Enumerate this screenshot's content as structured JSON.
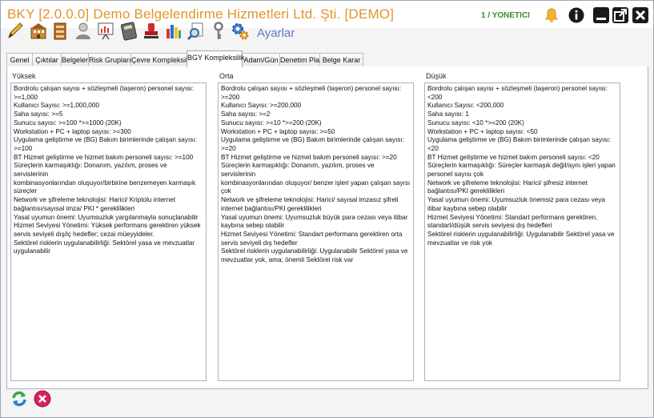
{
  "window": {
    "title": "BKY [2.0.0.0] Demo Belgelendirme Hizmetleri Ltd. Şti. [DEMO]",
    "user": "1 / YONETICI"
  },
  "titlebar_icons": [
    "bell-icon",
    "info-icon",
    "minimize-icon",
    "popout-icon",
    "close-icon"
  ],
  "toolbar": {
    "buttons": [
      "pencil-icon",
      "building-icon",
      "archive-icon",
      "user-icon",
      "presentation-icon",
      "calculator-icon",
      "stamp-icon",
      "chart-icon",
      "search-doc-icon",
      "key-icon",
      "settings-gear-icon"
    ],
    "settings_label": "Ayarlar"
  },
  "tabs": [
    {
      "label": "Genel",
      "active": false
    },
    {
      "label": "Çıktılar",
      "active": false
    },
    {
      "label": "Belgeler",
      "active": false
    },
    {
      "label": "Risk Grupları",
      "active": false
    },
    {
      "label": "Çevre Kompleksilik",
      "active": false
    },
    {
      "label": "BGY Kompleksilik",
      "active": true
    },
    {
      "label": "Adam/Gün",
      "active": false
    },
    {
      "label": "Denetim Planı",
      "active": false
    },
    {
      "label": "Belge Karar",
      "active": false
    }
  ],
  "columns": [
    {
      "header": "Yüksek",
      "lines": [
        "Bordrolu çalışan sayısı + sözleşmeli (taşeron) personel sayısı:",
        ">=1,000",
        "Kullanıcı Sayısı: >=1,000,000",
        "Saha sayısı: >=5",
        "Sunucu sayısı: >=100 *>=1000 (20K)",
        "Workstation + PC + laptop sayısı: >=300",
        "Uygulama geliştirme ve (BG) Bakım birimlerinde çalışan sayısı:",
        ">=100",
        "BT Hizmet geliştirme ve hizmet bakım personeli sayısı: >=100",
        "Süreçlerin karmaşıklığı: Donanım, yazılım, proses ve servislerinin",
        "kombinasyonlarından oluşuyor/birbirine benzemeyen karmaşık",
        "süreçler",
        "Network ve şifreleme teknolojisi: Harici/ Kriptolu internet",
        "bağlantısı/sayısal imza/ PKI * gereklilikleri",
        "Yasal uyumun önemi: Uyumsuzluk yargılanmayla sonuçlanabilir",
        "Hizmet Seviyesi Yönetimi: Yüksek performans gerektiren yüksek",
        "servis seviyeli dış/iç hedefler; cezai müeyyideler.",
        "Sektörel risklerin uygulanabilirliği: Sektörel yasa ve mevzuatlar",
        "uygulanabilir"
      ]
    },
    {
      "header": "Orta",
      "lines": [
        "Bordrolu çalışan sayısı + sözleşmeli (taşeron) personel sayısı:",
        ">=200",
        "Kullanıcı Sayısı: >=200,000",
        "Saha sayısı: >=2",
        "Sunucu sayısı: >=10 *>=200 (20K)",
        "Workstation + PC + laptop sayısı: >=50",
        "Uygulama geliştirme ve (BG) Bakım birimlerinde çalışan sayısı:",
        ">=20",
        "BT Hizmet geliştirme ve hizmet bakım personeli sayısı: >=20",
        "Süreçlerin karmaşıklığı: Donanım, yazılım, proses ve servislerinin",
        "kombinasyonlarından oluşuyor/ benzer işleri yapan çalışan sayısı",
        "çok",
        "Network ve şifreleme teknolojisi: Harici/ sayısal imzasız şifreli",
        "internet bağlantısı/PKI gereklilikleri",
        "Yasal uyumun önemi: Uyumsuzluk büyük para cezası veya itibar",
        "kaybına sebep olabilir",
        "Hizmet Seviyesi Yönetimi: Standart performans gerektiren orta",
        "servis seviyeli dış hedefler",
        "Sektörel risklerin uygulanabilirliği: Uygulanabilir Sektörel yasa ve",
        "mevzuatlar yok, ama; önemli Sektörel risk var"
      ]
    },
    {
      "header": "Düşük",
      "lines": [
        "Bordrolu çalışan sayısı + sözleşmeli (taşeron) personel sayısı:",
        "<200",
        "Kullanıcı Sayısı: <200,000",
        "Saha sayısı: 1",
        "Sunucu sayısı: <10 *>=200 (20K)",
        "Workstation + PC + laptop sayısı: <50",
        "Uygulama geliştirme ve (BG) Bakım birimlerinde çalışan sayısı:",
        "<20",
        "BT Hizmet geliştirme ve hizmet bakım personeli sayısı: <20",
        "Süreçlerin karmaşıklığı: Süreçler karmaşık değil/aynı işleri yapan",
        "personel sayısı çok",
        "Network ve şifreleme teknolojisi: Harici/ şifresiz internet",
        "bağlantısı/PKI gereklilikleri",
        "Yasal uyumun önemi: Uyumsuzluk önemsiz para cezası veya",
        "itibar kaybına sebep olabilir",
        "Hizmet Seviyesi Yönetimi: Standart performans gerektiren,",
        "standart/düşük servis seviyesi dış hedefleri",
        "Sektörel risklerin uygulanabilirliği: Uygulanabilir Sektörel yasa ve",
        "mevzuatlar ve risk yok"
      ]
    }
  ],
  "bottom_buttons": [
    "refresh-icon",
    "cancel-icon"
  ],
  "colors": {
    "title": "#e0952a",
    "user": "#3d8a2a",
    "settings": "#5b79c9"
  }
}
